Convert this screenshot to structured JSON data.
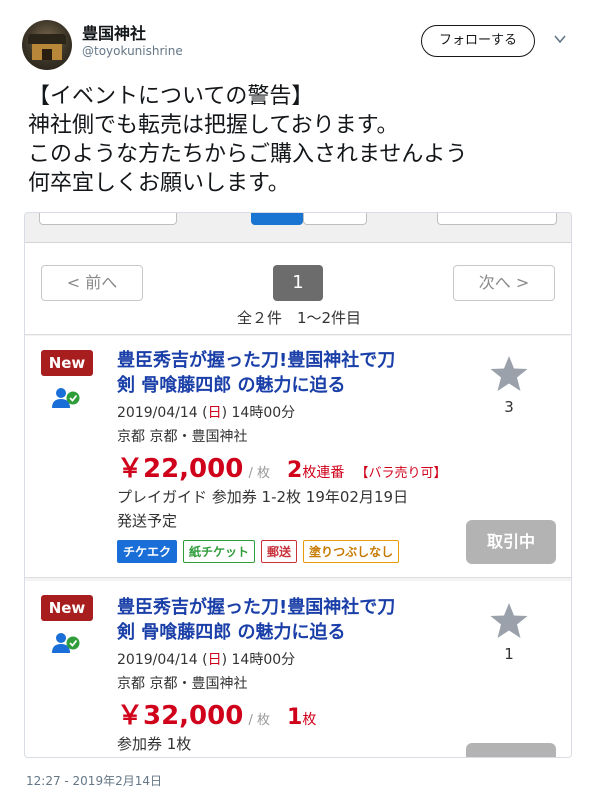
{
  "tweet": {
    "display_name": "豊国神社",
    "handle": "@toyokunishrine",
    "follow_label": "フォローする",
    "text_lines": [
      "【イベントについての警告】",
      "神社側でも転売は把握しております。",
      "このような方たちからご購入されませんよう",
      "何卒宜しくお願いします。"
    ],
    "timestamp": "12:27 - 2019年2月14日"
  },
  "pagination": {
    "prev_label": "< 前へ",
    "current_page": "1",
    "next_label": "次へ >",
    "count_text": "全２件　1〜2件目"
  },
  "listings": [
    {
      "badge": "New",
      "title_line1": "豊臣秀吉が握った刀!豊国神社で刀",
      "title_line2": "剣 骨喰藤四郎 の魅力に迫る",
      "date_prefix": "2019/04/14 (",
      "day": "日",
      "date_suffix": ") 14時00分",
      "venue": "京都 京都・豊国神社",
      "price": "￥22,000",
      "price_unit": "/ 枚",
      "qty": "2",
      "qty_unit": "枚連番",
      "qty_note": "【バラ売り可】",
      "detail": "プレイガイド 参加券 1-2枚 19年02月19日",
      "detail2": "発送予定",
      "tags": [
        "チケエク",
        "紙チケット",
        "郵送",
        "塗りつぶしなし"
      ],
      "fav_count": "3",
      "deal_label": "取引中"
    },
    {
      "badge": "New",
      "title_line1": "豊臣秀吉が握った刀!豊国神社で刀",
      "title_line2": "剣 骨喰藤四郎 の魅力に迫る",
      "date_prefix": "2019/04/14 (",
      "day": "日",
      "date_suffix": ") 14時00分",
      "venue": "京都 京都・豊国神社",
      "price": "￥32,000",
      "price_unit": "/ 枚",
      "qty": "1",
      "qty_unit": "枚",
      "detail": "参加券 1枚",
      "fav_count": "1"
    }
  ],
  "colors": {
    "title_blue": "#1a3fa8",
    "price_red": "#d0021b",
    "new_badge": "#a81e1e",
    "deal_gray": "#b3b3b3"
  }
}
